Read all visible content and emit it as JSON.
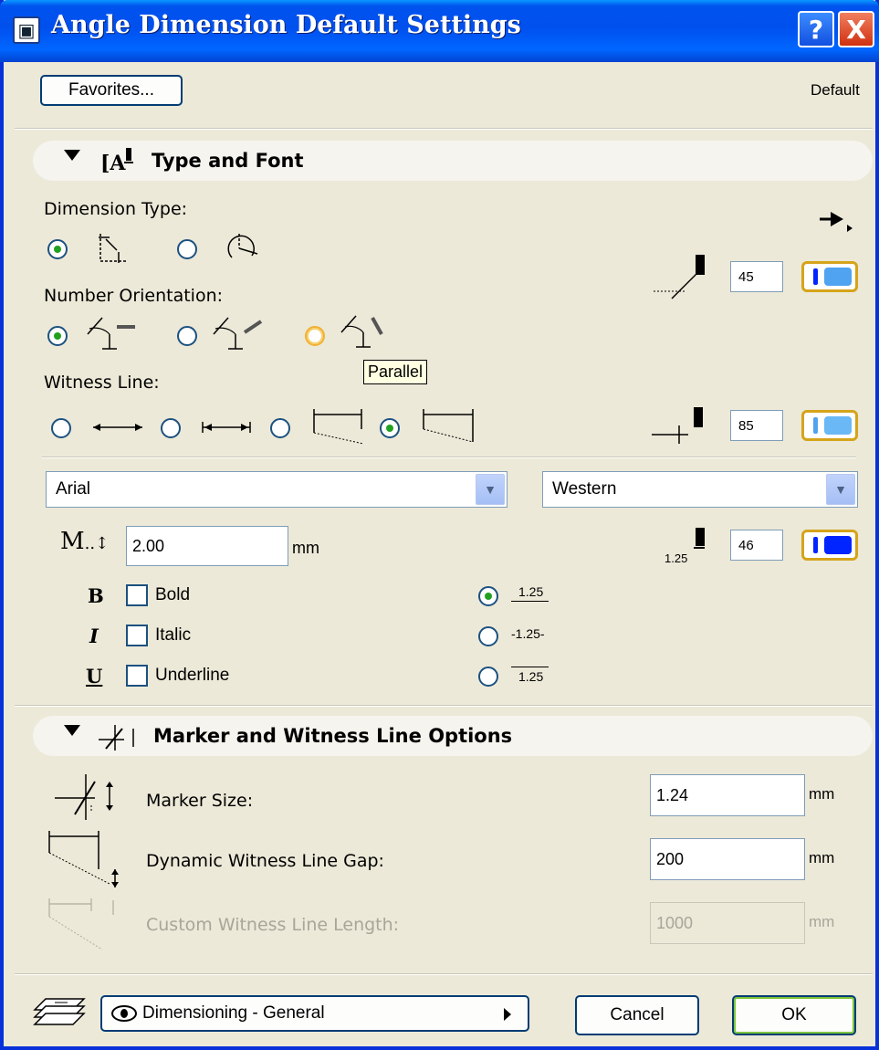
{
  "window": {
    "title": "Angle Dimension Default Settings",
    "help_label": "?",
    "close_label": "X"
  },
  "header": {
    "favorites_label": "Favorites...",
    "status_text": "Default"
  },
  "type_font": {
    "title": "Type and Font",
    "dimension_type_label": "Dimension Type:",
    "number_orientation_label": "Number Orientation:",
    "witness_line_label": "Witness Line:",
    "tooltip": "Parallel",
    "pen_values": [
      "45",
      "85",
      "46"
    ],
    "font_name": "Arial",
    "script_name": "Western",
    "text_size": "2.00",
    "text_size_unit": "mm",
    "sample_number": "1.25",
    "bold_label": "Bold",
    "italic_label": "Italic",
    "underline_label": "Underline",
    "bold_glyph": "B",
    "italic_glyph": "I",
    "underline_glyph": "U",
    "size_glyph": "M",
    "sample_option_labels": [
      "1.25",
      "-1.25-",
      "1.25"
    ]
  },
  "marker": {
    "title": "Marker and Witness Line Options",
    "marker_size_label": "Marker Size:",
    "marker_size_value": "1.24",
    "gap_label": "Dynamic Witness Line Gap:",
    "gap_value": "200",
    "custom_length_label": "Custom Witness Line Length:",
    "custom_length_value": "1000",
    "unit": "mm"
  },
  "footer": {
    "layer_label": "Dimensioning - General",
    "cancel_label": "Cancel",
    "ok_label": "OK"
  },
  "colors": {
    "title_blue": "#0053ee",
    "pen_light_blue": "#4fa3f0",
    "pen_dark_blue": "#0025ff",
    "radio_green": "#21a121"
  }
}
